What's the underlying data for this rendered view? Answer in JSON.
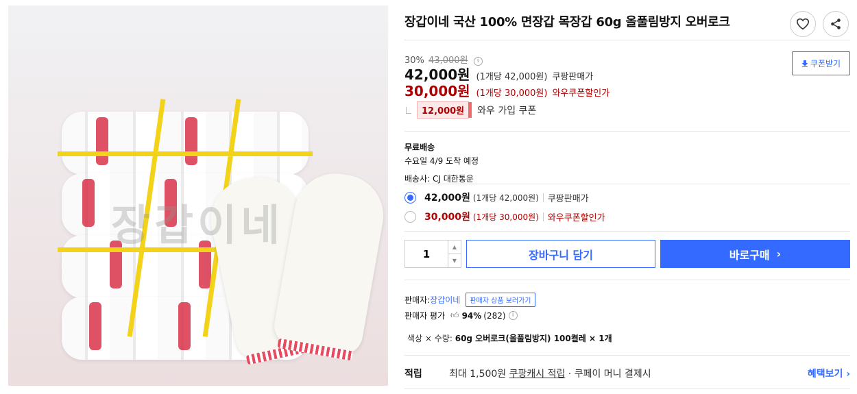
{
  "product": {
    "title": "장갑이네 국산 100% 면장갑 목장갑 60g 올풀림방지 오버로크",
    "watermark": "장갑이네",
    "image_bg": "#ecdedf"
  },
  "actions": {
    "wishlist_icon": "heart-icon",
    "share_icon": "share-icon"
  },
  "price": {
    "discount_rate": "30%",
    "original_price": "43,000원",
    "main_price": "42,000원",
    "main_unit": "(1개당 42,000원)",
    "main_seller": "쿠팡판매가",
    "wow_price": "30,000원",
    "wow_unit": "(1개당 30,000원)",
    "wow_seller": "와우쿠폰할인가",
    "coupon_button": "쿠폰받기",
    "wow_coupon_amount": "12,000원",
    "wow_coupon_label": "와우 가입 쿠폰"
  },
  "shipping": {
    "title": "무료배송",
    "arrival": "수요일 4/9 도착 예정",
    "carrier": "배송사: CJ 대한통운"
  },
  "options": [
    {
      "price": "42,000원",
      "unit": "(1개당 42,000원)",
      "seller": "쿠팡판매가",
      "selected": true
    },
    {
      "price": "30,000원",
      "unit": "(1개당 30,000원)",
      "seller": "와우쿠폰할인가",
      "selected": false
    }
  ],
  "purchase": {
    "quantity": "1",
    "cart_button": "장바구니 담기",
    "buy_button": "바로구매",
    "buy_arrow": "›"
  },
  "seller": {
    "label": "판매자:",
    "name": "장갑이네",
    "goto_label": "판매자 상품 보러가기",
    "rating_label": "판매자 평가",
    "rating_value": "94%",
    "rating_count": "(282)"
  },
  "option_summary": {
    "label": "색상 × 수량:",
    "value": "60g 오버로크(올풀림방지) 100켤레 × 1개"
  },
  "reward": {
    "title": "적립",
    "prefix": "최대 1,500원 ",
    "cash_text": "쿠팡캐시 적립",
    "suffix": " · 쿠페이 머니 결제시",
    "benefit_link": "혜택보기 ›"
  },
  "colors": {
    "accent": "#346aff",
    "wow_red": "#ae0000"
  }
}
